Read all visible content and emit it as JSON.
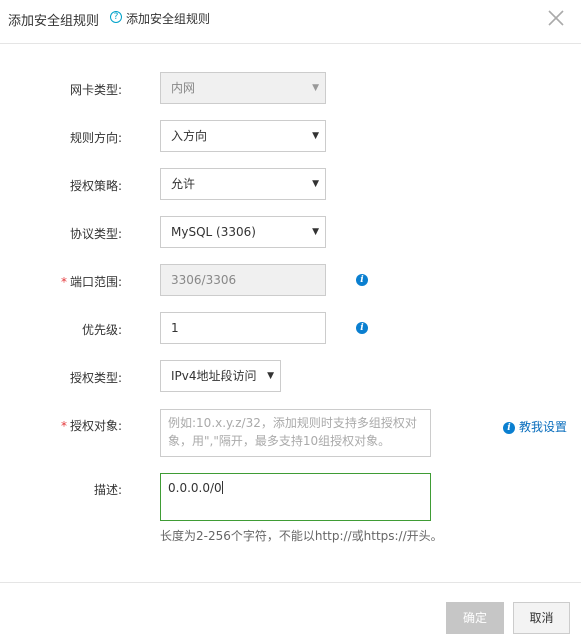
{
  "dialog": {
    "title": "添加安全组规则",
    "help_icon": "?",
    "help_link": "添加安全组规则",
    "close_icon": "close-icon"
  },
  "form": {
    "nic_type": {
      "label": "网卡类型:",
      "value": "内网",
      "disabled": true
    },
    "direction": {
      "label": "规则方向:",
      "value": "入方向"
    },
    "policy": {
      "label": "授权策略:",
      "value": "允许"
    },
    "protocol": {
      "label": "协议类型:",
      "value": "MySQL (3306)"
    },
    "port_range": {
      "required_mark": "*",
      "label": "端口范围:",
      "value": "3306/3306",
      "disabled": true
    },
    "priority": {
      "label": "优先级:",
      "value": "1"
    },
    "auth_type": {
      "label": "授权类型:",
      "value": "IPv4地址段访问"
    },
    "auth_object": {
      "required_mark": "*",
      "label": "授权对象:",
      "placeholder": "例如:10.x.y.z/32，添加规则时支持多组授权对象，用\",\"隔开，最多支持10组授权对象。",
      "teach_link": "教我设置"
    },
    "description": {
      "label": "描述:",
      "value": "0.0.0.0/0",
      "hint": "长度为2-256个字符，不能以http://或https://开头。"
    },
    "caret": "▼",
    "info_icon": "i"
  },
  "footer": {
    "ok_label": "确定",
    "cancel_label": "取消"
  },
  "colors": {
    "link": "#0a6ebd",
    "help_icon": "#00a2ca",
    "info_icon": "#0a7fd0",
    "required": "#e4393c",
    "focus_border": "#3f9c35",
    "disabled_button": "#c6c6c6"
  }
}
